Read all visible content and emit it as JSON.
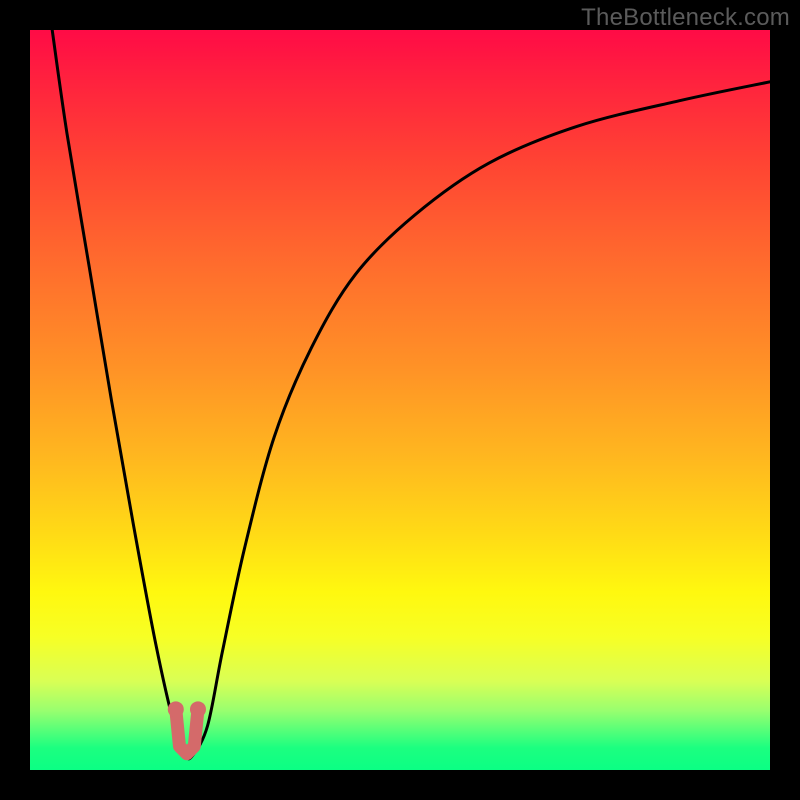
{
  "watermark": "TheBottleneck.com",
  "chart_data": {
    "type": "line",
    "title": "",
    "xlabel": "",
    "ylabel": "",
    "xlim": [
      0,
      100
    ],
    "ylim": [
      0,
      100
    ],
    "grid": false,
    "legend": false,
    "series": [
      {
        "name": "bottleneck-curve",
        "color": "#000000",
        "x": [
          3,
          5,
          8,
          11,
          14,
          17,
          19.5,
          21,
          22,
          24,
          26,
          29,
          33,
          38,
          44,
          52,
          62,
          74,
          88,
          100
        ],
        "y": [
          100,
          86,
          68,
          50,
          33,
          17,
          6,
          2,
          2,
          6,
          16,
          30,
          45,
          57,
          67,
          75,
          82,
          87,
          90.5,
          93
        ]
      },
      {
        "name": "min-marker",
        "color": "#d46a6a",
        "type": "marker-path",
        "x": [
          19.7,
          20.2,
          21.2,
          22.2,
          22.7
        ],
        "y": [
          8.2,
          3.2,
          2.2,
          3.2,
          8.2
        ]
      }
    ],
    "background_gradient": {
      "top": "#ff0b46",
      "mid_upper": "#ff9326",
      "mid_lower": "#fff80f",
      "bottom": "#0bff84"
    }
  }
}
